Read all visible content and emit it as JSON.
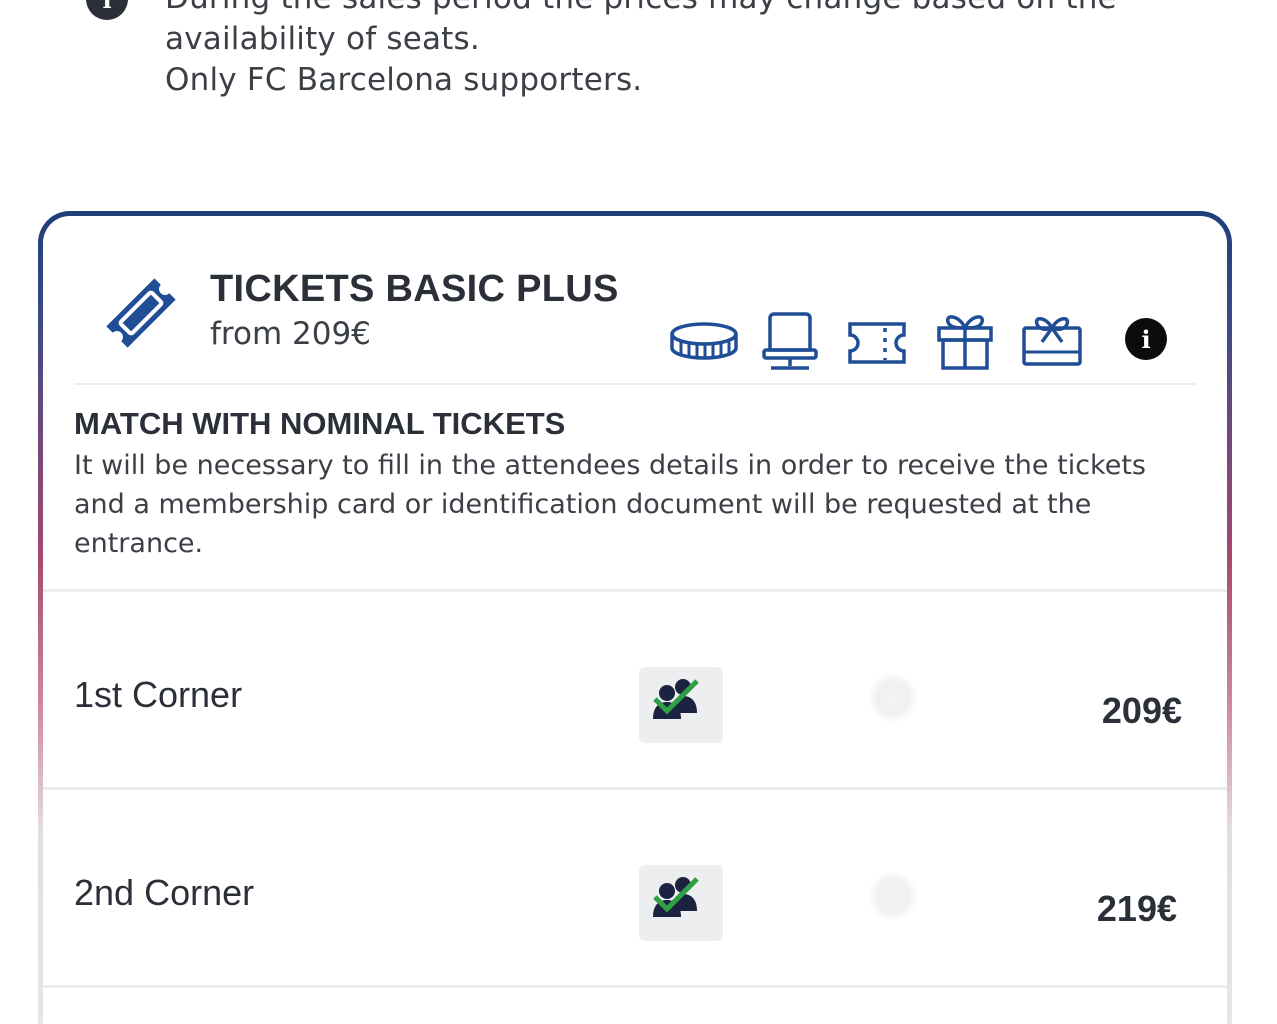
{
  "notice": {
    "icon": "info-icon",
    "lines": [
      "During the sales period the prices may change based on the",
      "availability of seats.",
      "Only FC Barcelona supporters."
    ]
  },
  "card": {
    "icon": "ticket-icon",
    "title": "TICKETS BASIC PLUS",
    "from": "from 209€",
    "features": [
      "stadium-icon",
      "seat-icon",
      "ticket-icon",
      "gift-icon",
      "gift-card-icon"
    ],
    "info_icon": "info-icon",
    "section_heading": "MATCH WITH NOMINAL TICKETS",
    "section_lines": [
      "It will be necessary to fill in the attendees details in order to receive the tickets",
      "and a membership card or identification document will be requested at the",
      "entrance."
    ],
    "options": [
      {
        "name": "1st Corner",
        "price": "209€"
      },
      {
        "name": "2nd Corner",
        "price": "219€"
      }
    ]
  },
  "colors": {
    "brand_blue": "#1f4e96",
    "text_dark": "#2b2f38",
    "check_green": "#2ea043",
    "border_gradient_top": "#1f3f7a",
    "border_gradient_mid": "#a5486f"
  }
}
